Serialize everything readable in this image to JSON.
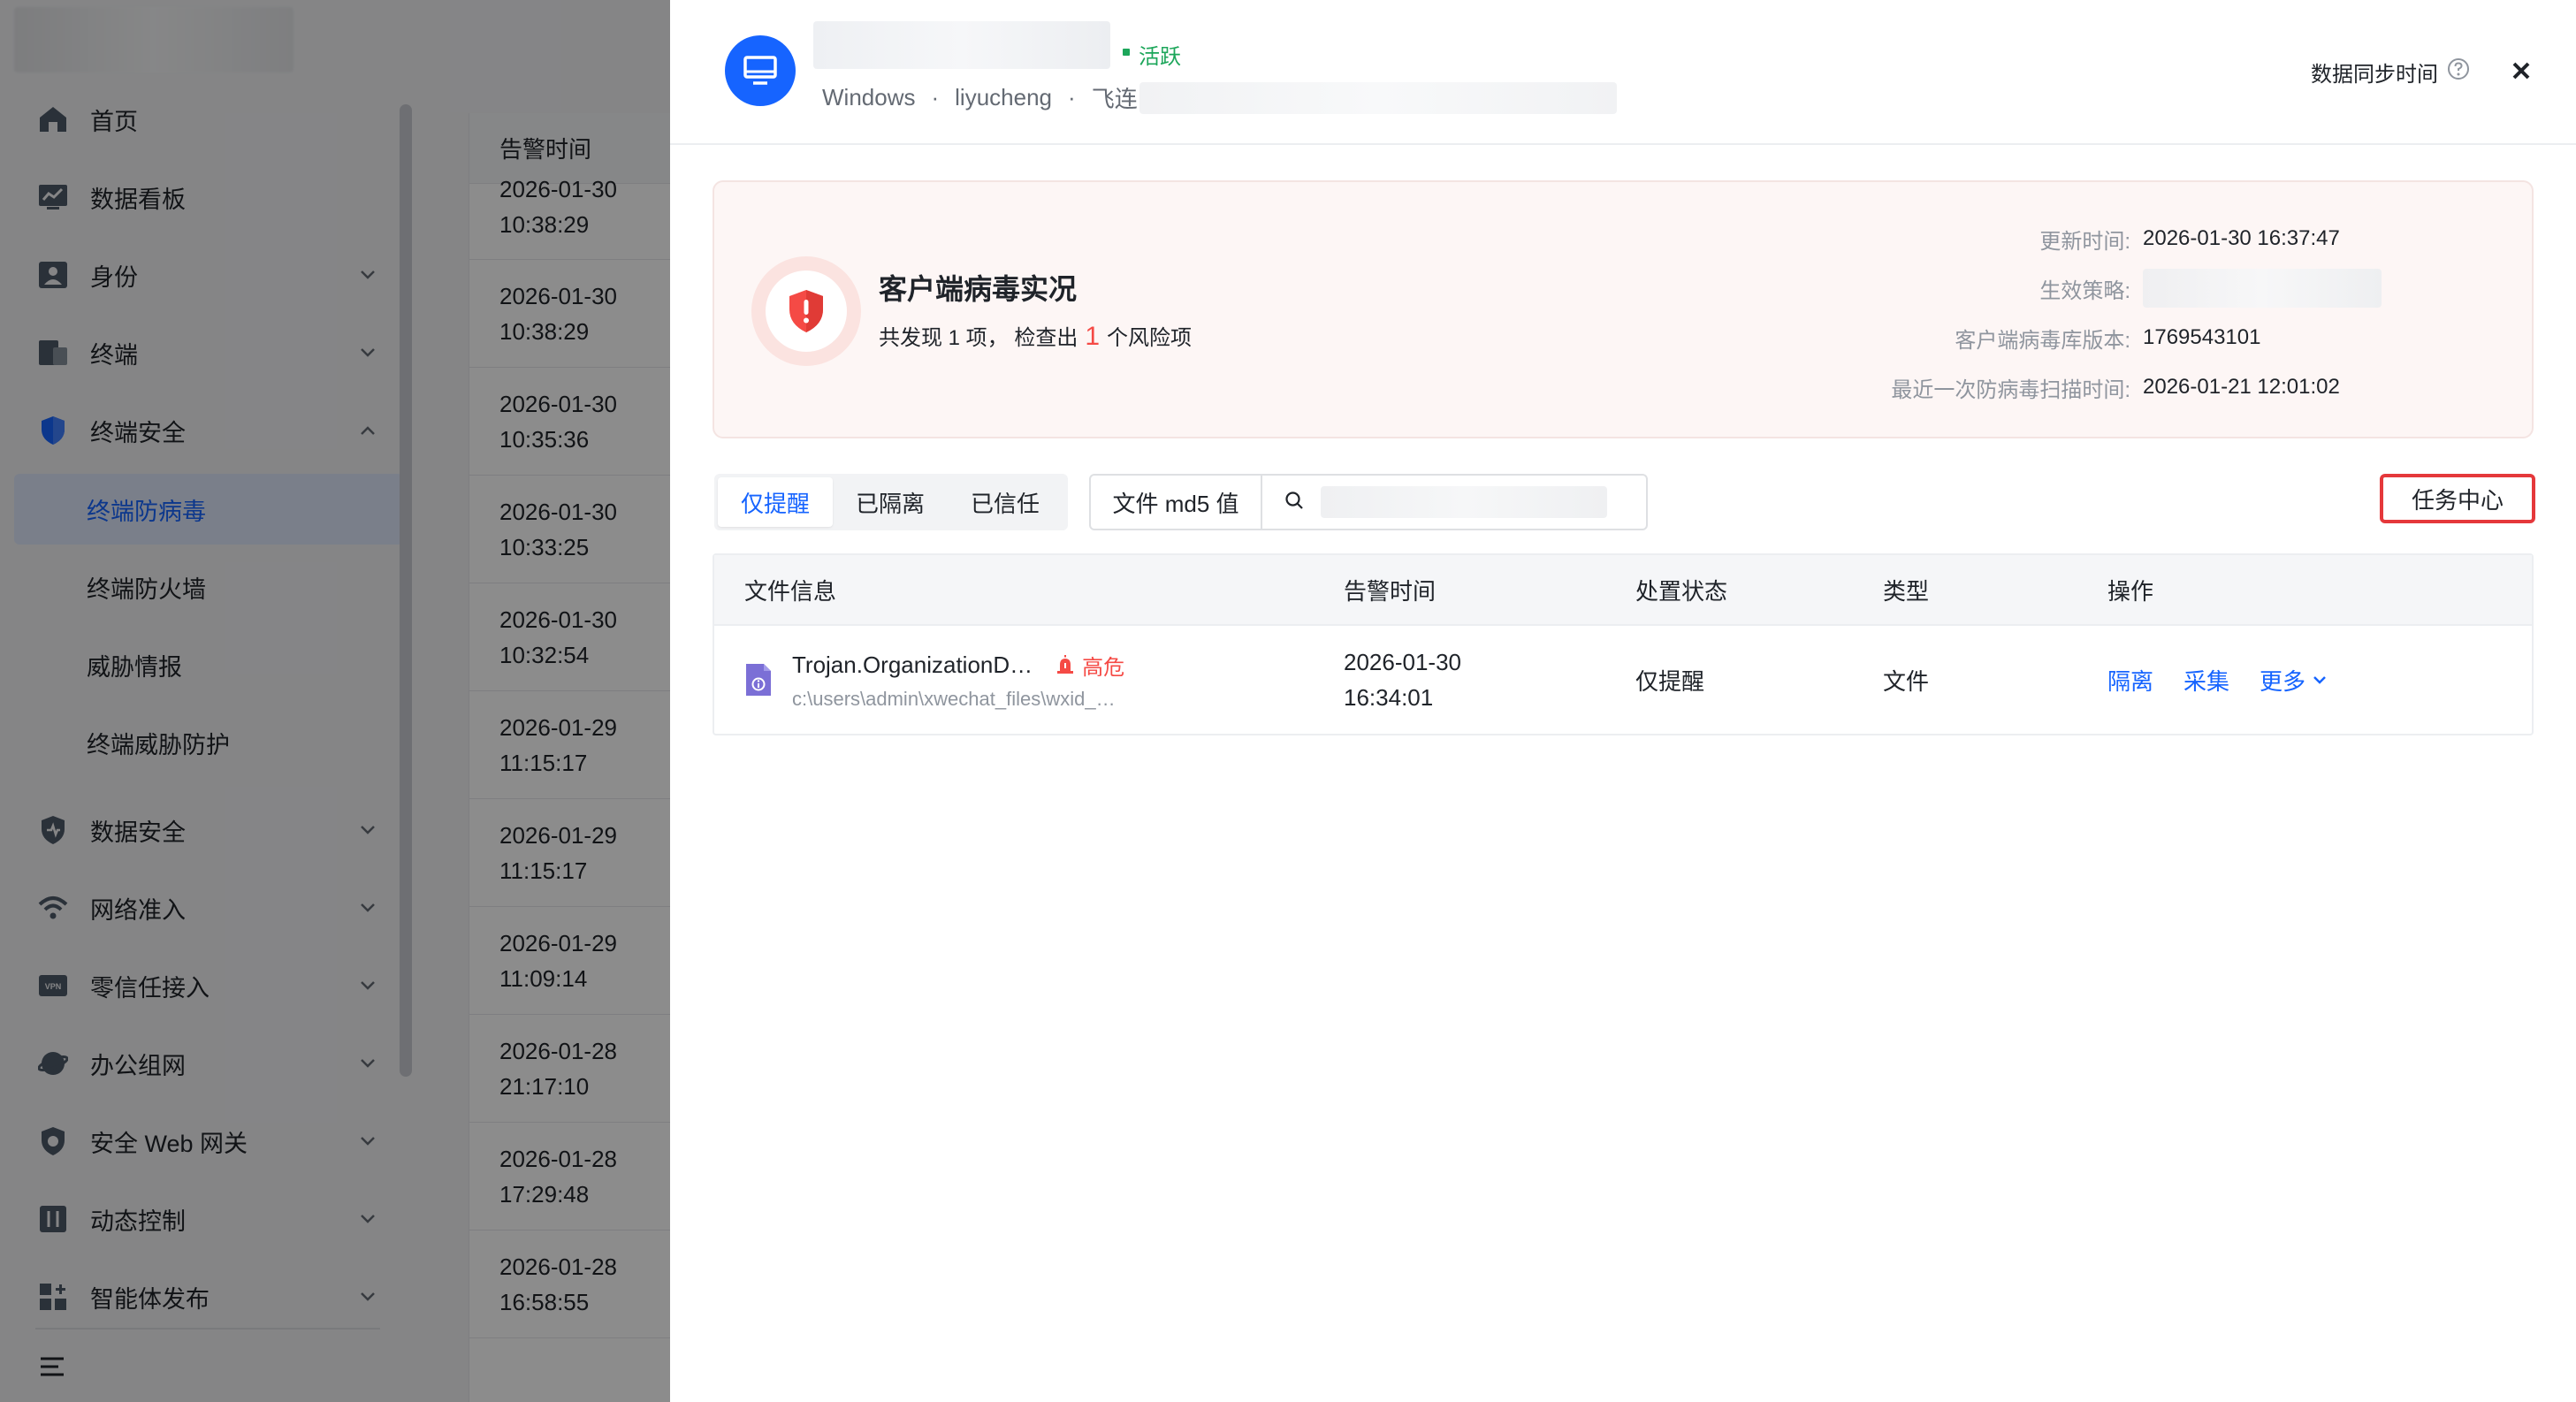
{
  "sidebar": {
    "items": [
      {
        "label": "首页"
      },
      {
        "label": "数据看板"
      },
      {
        "label": "身份"
      },
      {
        "label": "终端"
      },
      {
        "label": "终端安全"
      },
      {
        "label": "数据安全"
      },
      {
        "label": "网络准入"
      },
      {
        "label": "零信任接入"
      },
      {
        "label": "办公组网"
      },
      {
        "label": "安全 Web 网关"
      },
      {
        "label": "动态控制"
      },
      {
        "label": "智能体发布"
      }
    ],
    "sub_items": [
      {
        "label": "终端防病毒",
        "active": true
      },
      {
        "label": "终端防火墙"
      },
      {
        "label": "威胁情报"
      },
      {
        "label": "终端威胁防护"
      }
    ]
  },
  "bg_table": {
    "header": "告警时间",
    "rows": [
      {
        "date": "2026-01-30",
        "time": "10:38:29"
      },
      {
        "date": "2026-01-30",
        "time": "10:38:29"
      },
      {
        "date": "2026-01-30",
        "time": "10:35:36"
      },
      {
        "date": "2026-01-30",
        "time": "10:33:25"
      },
      {
        "date": "2026-01-30",
        "time": "10:32:54"
      },
      {
        "date": "2026-01-29",
        "time": "11:15:17"
      },
      {
        "date": "2026-01-29",
        "time": "11:15:17"
      },
      {
        "date": "2026-01-29",
        "time": "11:09:14"
      },
      {
        "date": "2026-01-28",
        "time": "21:17:10"
      },
      {
        "date": "2026-01-28",
        "time": "17:29:48"
      },
      {
        "date": "2026-01-28",
        "time": "16:58:55"
      }
    ]
  },
  "drawer": {
    "status": "活跃",
    "os": "Windows",
    "user": "liyucheng",
    "client": "飞连",
    "sync_label": "数据同步时间",
    "summary": {
      "title": "客户端病毒实况",
      "desc_prefix": "共发现 1 项， 检查出",
      "risk_count": "1",
      "desc_suffix": "个风险项",
      "update_time_label": "更新时间:",
      "update_time": "2026-01-30 16:37:47",
      "policy_label": "生效策略:",
      "db_version_label": "客户端病毒库版本:",
      "db_version": "1769543101",
      "last_scan_label": "最近一次防病毒扫描时间:",
      "last_scan": "2026-01-21 12:01:02"
    },
    "tabs": [
      "仅提醒",
      "已隔离",
      "已信任"
    ],
    "filter_field": "文件 md5 值",
    "task_center": "任务中心",
    "table": {
      "headers": [
        "文件信息",
        "告警时间",
        "处置状态",
        "类型",
        "操作"
      ],
      "rows": [
        {
          "file_name": "Trojan.OrganizationD…",
          "risk": "高危",
          "path": "c:\\users\\admin\\xwechat_files\\wxid_…",
          "date": "2026-01-30",
          "time": "16:34:01",
          "status": "仅提醒",
          "type": "文件",
          "actions": {
            "isolate": "隔离",
            "collect": "采集",
            "more": "更多"
          }
        }
      ]
    }
  },
  "colors": {
    "accent": "#1664ff",
    "danger": "#f54a45",
    "success": "#1ca65a",
    "highlight_border": "#e5383b"
  }
}
